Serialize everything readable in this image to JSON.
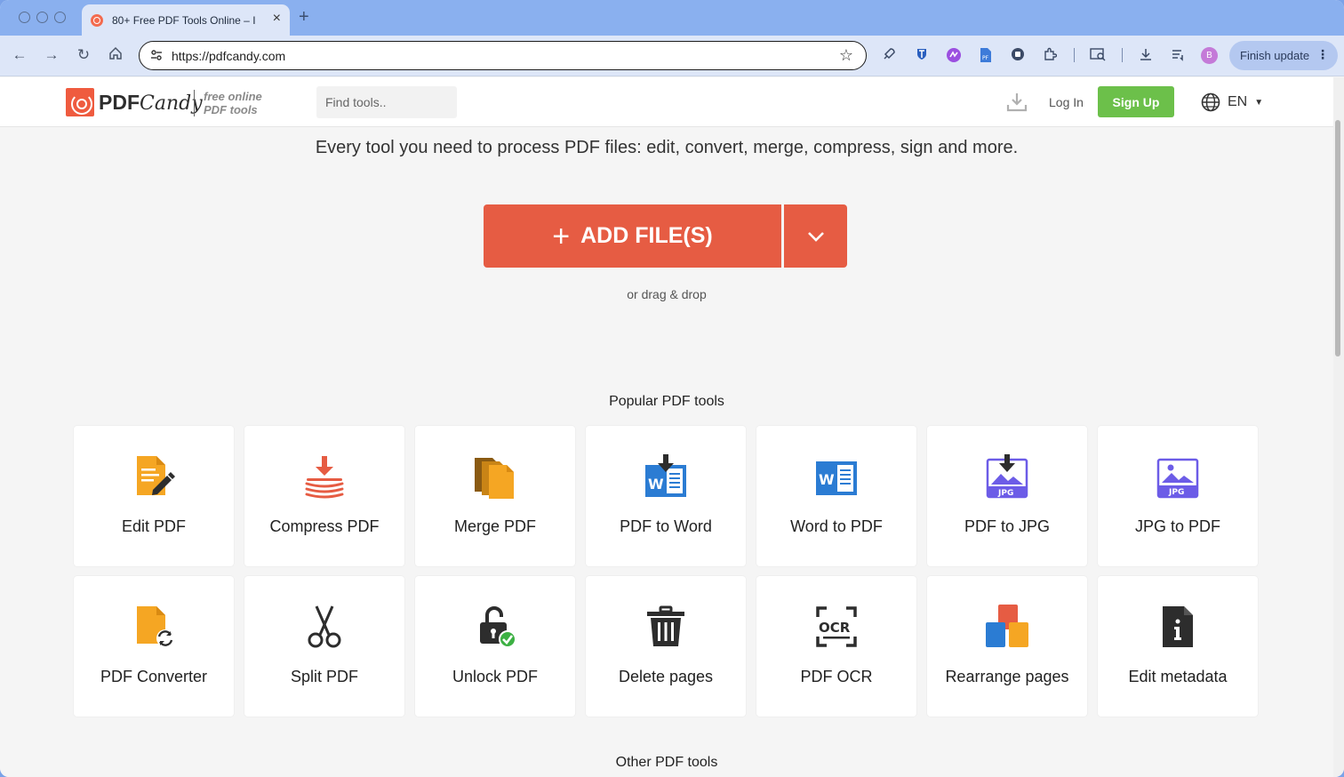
{
  "browser": {
    "tab_title": "80+ Free PDF Tools Online – I",
    "url": "https://pdfcandy.com",
    "profile_initial": "B",
    "finish_update": "Finish update"
  },
  "header": {
    "logo_pdf": "PDF",
    "logo_candy": "Candy",
    "tagline_line1": "free online",
    "tagline_line2": "PDF tools",
    "search_placeholder": "Find tools..",
    "login": "Log In",
    "signup": "Sign Up",
    "language": "EN"
  },
  "hero": {
    "headline": "Every tool you need to process PDF files: edit, convert, merge, compress, sign and more.",
    "add_files": "ADD FILE(S)",
    "drag_drop": "or drag & drop"
  },
  "popular": {
    "title": "Popular PDF tools",
    "tools": [
      {
        "label": "Edit PDF",
        "icon": "edit-pdf-icon"
      },
      {
        "label": "Compress PDF",
        "icon": "compress-icon"
      },
      {
        "label": "Merge PDF",
        "icon": "merge-icon"
      },
      {
        "label": "PDF to Word",
        "icon": "pdf-to-word-icon"
      },
      {
        "label": "Word to PDF",
        "icon": "word-icon"
      },
      {
        "label": "PDF to JPG",
        "icon": "pdf-to-jpg-icon"
      },
      {
        "label": "JPG to PDF",
        "icon": "jpg-icon"
      },
      {
        "label": "PDF Converter",
        "icon": "converter-icon"
      },
      {
        "label": "Split PDF",
        "icon": "scissors-icon"
      },
      {
        "label": "Unlock PDF",
        "icon": "unlock-icon"
      },
      {
        "label": "Delete pages",
        "icon": "trash-icon"
      },
      {
        "label": "PDF OCR",
        "icon": "ocr-icon"
      },
      {
        "label": "Rearrange pages",
        "icon": "rearrange-icon"
      },
      {
        "label": "Edit metadata",
        "icon": "metadata-icon"
      }
    ]
  },
  "other": {
    "title": "Other PDF tools"
  },
  "colors": {
    "brand": "#e65c43",
    "signup": "#6cc04a",
    "accent_orange": "#f5a623",
    "word_blue": "#2b7cd3",
    "jpg_purple": "#6c5ce7"
  }
}
